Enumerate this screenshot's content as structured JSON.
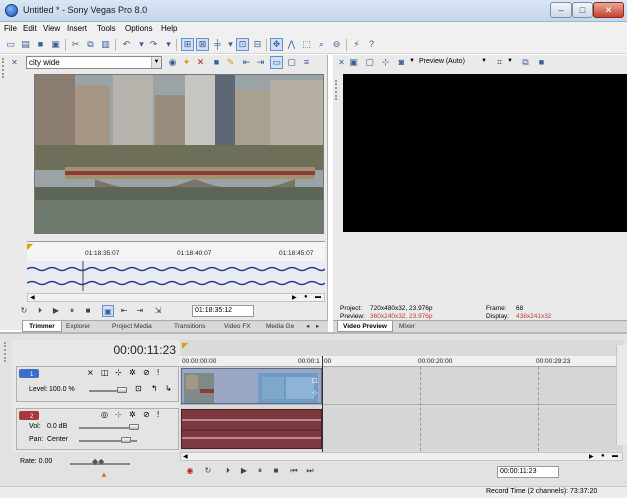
{
  "window": {
    "title": "Untitled * - Sony Vegas Pro 8.0",
    "min": "–",
    "max": "□",
    "close": "✕"
  },
  "menu": [
    "File",
    "Edit",
    "View",
    "Insert",
    "Tools",
    "Options",
    "Help"
  ],
  "trimmer": {
    "media_name": "city wide",
    "ruler_labels": [
      "01:18:35:07",
      "01:18:40:07",
      "01:18:45:07"
    ],
    "time_display": "01:18:35:12"
  },
  "left_tabs": [
    "Trimmer",
    "Explorer",
    "Project Media",
    "Transitions",
    "Video FX",
    "Media Ge"
  ],
  "preview": {
    "mode_label": "Preview (Auto)",
    "project_label": "Project:",
    "project_value": "720x480x32, 23.976p",
    "preview_label": "Preview:",
    "preview_value": "360x240x32, 23.976p",
    "frame_label": "Frame:",
    "frame_value": "68",
    "display_label": "Display:",
    "display_value": "438x241x32"
  },
  "right_tabs": [
    "Video Preview",
    "Mixer"
  ],
  "timeline": {
    "current_time": "00:00:11:23",
    "ruler_labels": [
      "00:00:00:00",
      "00:00:1",
      "00",
      "00:00:20:00",
      "00:00:29:23"
    ],
    "video_track": {
      "level_label": "Level:",
      "level_value": "100.0 %",
      "number": "1"
    },
    "audio_track": {
      "vol_label": "Vol:",
      "vol_value": "0.0 dB",
      "pan_label": "Pan:",
      "pan_value": "Center",
      "number": "2"
    },
    "rate_label": "Rate: 0.00",
    "bottom_time": "00:00:11:23"
  },
  "status": {
    "text": "Record Time (2 channels): 73:37:20"
  },
  "colors": {
    "video_track": "#3b6fc9",
    "audio_track": "#a8383e",
    "preview_values": "#c0392b"
  }
}
